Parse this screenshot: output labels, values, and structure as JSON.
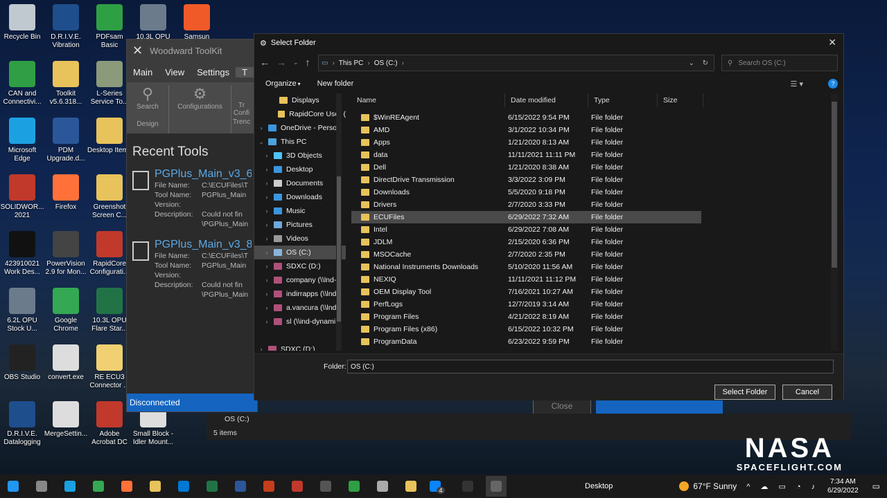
{
  "desktop_icons": [
    {
      "label": "Recycle Bin",
      "color": "#c0c8d0"
    },
    {
      "label": "D.R.I.V.E. Vibration",
      "color": "#1e4e8c"
    },
    {
      "label": "PDFsam Basic",
      "color": "#2ea043"
    },
    {
      "label": "10.3L OPU",
      "color": "#6b7b8b"
    },
    {
      "label": "Samsun",
      "color": "#f05a28"
    },
    {
      "label": "CAN and Connectivi...",
      "color": "#2f9e44"
    },
    {
      "label": "Toolkit v5.6.318...",
      "color": "#e8c25a"
    },
    {
      "label": "L-Series Service To...",
      "color": "#8a9a7a"
    },
    {
      "label": "Microsoft Edge",
      "color": "#1ba1e2"
    },
    {
      "label": "PDM Upgrade.d...",
      "color": "#2b579a"
    },
    {
      "label": "Desktop Items",
      "color": "#e8c25a"
    },
    {
      "label": "SOLIDWOR... 2021",
      "color": "#c0392b"
    },
    {
      "label": "Firefox",
      "color": "#ff7139"
    },
    {
      "label": "Greenshot Screen C...",
      "color": "#e8c25a"
    },
    {
      "label": "423910021 Work Des...",
      "color": "#111111"
    },
    {
      "label": "PowerVision 2.9 for Mon...",
      "color": "#444444"
    },
    {
      "label": "RapidCore Configurati...",
      "color": "#c0392b"
    },
    {
      "label": "6.2L OPU Stock U...",
      "color": "#6b7b8b"
    },
    {
      "label": "Google Chrome",
      "color": "#34a853"
    },
    {
      "label": "10.3L OPU Flare Star...",
      "color": "#217346"
    },
    {
      "label": "OBS Studio",
      "color": "#222222"
    },
    {
      "label": "convert.exe",
      "color": "#dddddd"
    },
    {
      "label": "RE ECU3 Connector ...",
      "color": "#f0d070"
    },
    {
      "label": "D.R.I.V.E. Datalogging",
      "color": "#1e4e8c"
    },
    {
      "label": "MergeSettin...",
      "color": "#dddddd"
    },
    {
      "label": "Adobe Acrobat DC",
      "color": "#c0392b"
    },
    {
      "label": "Small Block - Idler Mount...",
      "color": "#dddddd"
    }
  ],
  "woodward": {
    "title": "Woodward ToolKit",
    "tabs": [
      "Main",
      "View",
      "Settings",
      "T"
    ],
    "ribbon": {
      "search": "Search",
      "configurations": "Configurations",
      "design": "Design",
      "trend_partial": "Trenc",
      "config_partial": "Confi",
      "tr_partial": "Tr"
    },
    "recent_title": "Recent Tools",
    "tools": [
      {
        "name": "PGPlus_Main_v3_6",
        "file_name": "C:\\ECUFiles\\T",
        "tool_name": "PGPlus_Main",
        "version": "",
        "description": "Could not fin",
        "desc2": "\\PGPlus_Main"
      },
      {
        "name": "PGPlus_Main_v3_8",
        "file_name": "C:\\ECUFiles\\T",
        "tool_name": "PGPlus_Main",
        "version": "",
        "description": "Could not fin",
        "desc2": "\\PGPlus_Main"
      }
    ],
    "labels": {
      "file_name": "File Name:",
      "tool_name": "Tool Name:",
      "version": "Version:",
      "description": "Description:"
    },
    "status": "Disconnected"
  },
  "background_window": {
    "close_label": "Close",
    "nav_item": "OS (C:)",
    "status": "5 items"
  },
  "dialog": {
    "title": "Select Folder",
    "breadcrumb": [
      "This PC",
      "OS (C:)"
    ],
    "search_placeholder": "Search OS (C:)",
    "organize": "Organize",
    "new_folder": "New folder",
    "nav": [
      {
        "label": "Displays",
        "indent": 2,
        "color": "#e8c25a",
        "chev": ""
      },
      {
        "label": "RapidCore User (",
        "indent": 2,
        "color": "#e8c25a",
        "chev": ""
      },
      {
        "label": "OneDrive - Person",
        "indent": 0,
        "color": "#3a96dd",
        "chev": "›"
      },
      {
        "label": "This PC",
        "indent": 0,
        "color": "#4aa3df",
        "chev": "⌄"
      },
      {
        "label": "3D Objects",
        "indent": 1,
        "color": "#4fc3f7",
        "chev": "›"
      },
      {
        "label": "Desktop",
        "indent": 1,
        "color": "#3a96dd",
        "chev": "›"
      },
      {
        "label": "Documents",
        "indent": 1,
        "color": "#cccccc",
        "chev": "›"
      },
      {
        "label": "Downloads",
        "indent": 1,
        "color": "#3a96dd",
        "chev": "›"
      },
      {
        "label": "Music",
        "indent": 1,
        "color": "#3a96dd",
        "chev": "›"
      },
      {
        "label": "Pictures",
        "indent": 1,
        "color": "#6fa8dc",
        "chev": "›"
      },
      {
        "label": "Videos",
        "indent": 1,
        "color": "#999999",
        "chev": "›"
      },
      {
        "label": "OS (C:)",
        "indent": 1,
        "color": "#8ab4d8",
        "chev": "›",
        "selected": true
      },
      {
        "label": "SDXC (D:)",
        "indent": 1,
        "color": "#b0507a",
        "chev": "›"
      },
      {
        "label": "company (\\\\lnd-",
        "indent": 1,
        "color": "#b0507a",
        "chev": "›"
      },
      {
        "label": "indirrapps (\\\\lnd",
        "indent": 1,
        "color": "#b0507a",
        "chev": "›"
      },
      {
        "label": "a.vancura (\\\\lnd-",
        "indent": 1,
        "color": "#b0507a",
        "chev": "›"
      },
      {
        "label": "sl (\\\\ind-dynami",
        "indent": 1,
        "color": "#b0507a",
        "chev": "›"
      },
      {
        "label": "",
        "indent": 0,
        "color": "#191919",
        "chev": ""
      },
      {
        "label": "SDXC (D:)",
        "indent": 0,
        "color": "#b0507a",
        "chev": "›"
      }
    ],
    "columns": [
      "Name",
      "Date modified",
      "Type",
      "Size"
    ],
    "rows": [
      {
        "name": "$WinREAgent",
        "date": "6/15/2022 9:54 PM",
        "type": "File folder"
      },
      {
        "name": "AMD",
        "date": "3/1/2022 10:34 PM",
        "type": "File folder"
      },
      {
        "name": "Apps",
        "date": "1/21/2020 8:13 AM",
        "type": "File folder"
      },
      {
        "name": "data",
        "date": "11/11/2021 11:11 PM",
        "type": "File folder"
      },
      {
        "name": "Dell",
        "date": "1/21/2020 8:38 AM",
        "type": "File folder"
      },
      {
        "name": "DirectDrive Transmission",
        "date": "3/3/2022 3:09 PM",
        "type": "File folder"
      },
      {
        "name": "Downloads",
        "date": "5/5/2020 9:18 PM",
        "type": "File folder"
      },
      {
        "name": "Drivers",
        "date": "2/7/2020 3:33 PM",
        "type": "File folder"
      },
      {
        "name": "ECUFiles",
        "date": "6/29/2022 7:32 AM",
        "type": "File folder",
        "highlight": true
      },
      {
        "name": "Intel",
        "date": "6/29/2022 7:08 AM",
        "type": "File folder"
      },
      {
        "name": "JDLM",
        "date": "2/15/2020 6:36 PM",
        "type": "File folder"
      },
      {
        "name": "MSOCache",
        "date": "2/7/2020 2:35 PM",
        "type": "File folder"
      },
      {
        "name": "National Instruments Downloads",
        "date": "5/10/2020 11:56 AM",
        "type": "File folder"
      },
      {
        "name": "NEXIQ",
        "date": "11/11/2021 11:12 PM",
        "type": "File folder"
      },
      {
        "name": "OEM Display Tool",
        "date": "7/16/2021 10:27 AM",
        "type": "File folder"
      },
      {
        "name": "PerfLogs",
        "date": "12/7/2019 3:14 AM",
        "type": "File folder"
      },
      {
        "name": "Program Files",
        "date": "4/21/2022 8:19 AM",
        "type": "File folder"
      },
      {
        "name": "Program Files (x86)",
        "date": "6/15/2022 10:32 PM",
        "type": "File folder"
      },
      {
        "name": "ProgramData",
        "date": "6/23/2022 9:59 PM",
        "type": "File folder"
      }
    ],
    "folder_label": "Folder:",
    "folder_value": "OS (C:)",
    "select_button": "Select Folder",
    "cancel_button": "Cancel"
  },
  "taskbar": {
    "apps": [
      "start-icon",
      "task-view-icon",
      "edge-icon",
      "chrome-icon",
      "firefox-icon",
      "explorer-icon",
      "outlook-icon",
      "excel-icon",
      "word-icon",
      "powerpoint-icon",
      "solidworks-icon",
      "calculator-icon",
      "app-icon",
      "tools-icon",
      "folder-icon",
      "remote-icon",
      "obs-icon",
      "woodward-icon"
    ],
    "desktop_label": "Desktop",
    "weather": "67°F Sunny",
    "time": "7:34 AM",
    "date": "6/29/2022",
    "badge": "4"
  },
  "watermark": {
    "line1": "NASA",
    "line2": "SPACEFLIGHT.COM"
  }
}
